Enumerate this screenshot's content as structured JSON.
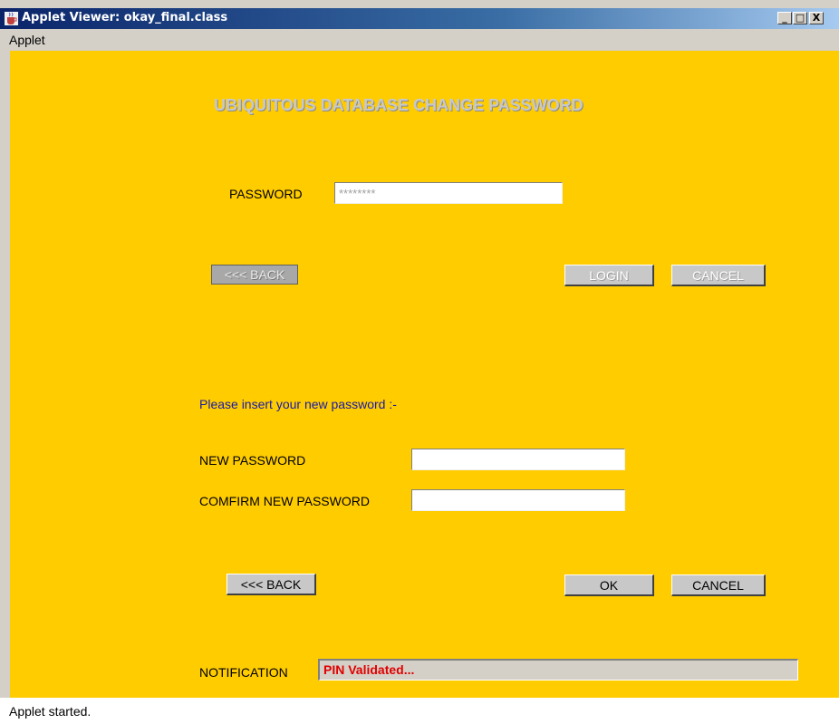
{
  "window": {
    "title": "Applet Viewer: okay_final.class",
    "controls": {
      "minimize": "_",
      "maximize": "□",
      "close": "X"
    }
  },
  "menu": {
    "items": [
      "Applet"
    ]
  },
  "form": {
    "heading": "UBIQUITOUS DATABASE CHANGE PASSWORD",
    "password_label": "PASSWORD",
    "password_value": "********",
    "back_disabled_label": "<<< BACK",
    "login_label": "LOGIN",
    "cancel_disabled_label": "CANCEL",
    "instruction": "Please insert your new password :-",
    "new_password_label": "NEW PASSWORD",
    "new_password_value": "",
    "confirm_password_label": "COMFIRM NEW PASSWORD",
    "confirm_password_value": "",
    "back_label": "<<< BACK",
    "ok_label": "OK",
    "cancel_label": "CANCEL",
    "notification_label": "NOTIFICATION",
    "notification_text": "PIN Validated..."
  },
  "status": {
    "text": "Applet started."
  },
  "colors": {
    "background": "#ffcc00",
    "notification_text": "#e00000",
    "instruction_text": "#1a1aa6"
  }
}
